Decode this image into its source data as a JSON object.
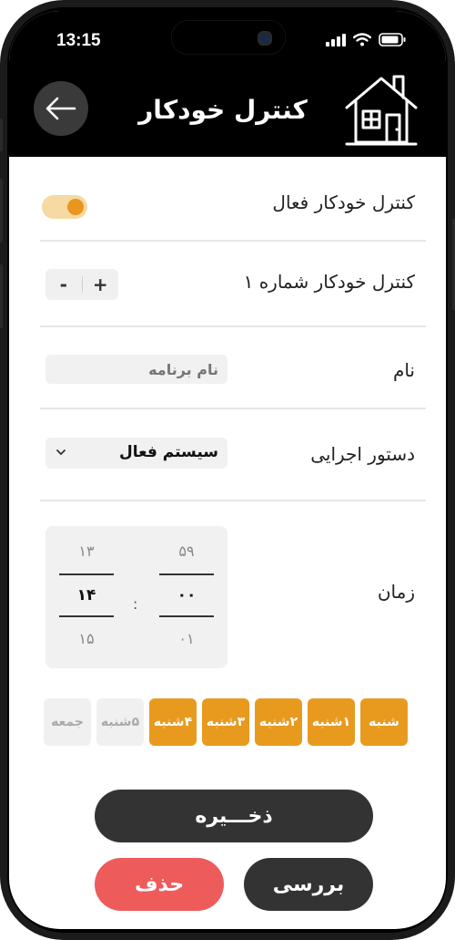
{
  "status_bar": {
    "time": "13:15"
  },
  "header": {
    "title": "کنترل خودکار",
    "back_icon": "arrow-left-icon",
    "logo_icon": "house-icon"
  },
  "rows": {
    "active": {
      "label": "کنترل خودکار فعال",
      "toggle_on": true
    },
    "number": {
      "label": "کنترل خودکار شماره ۱",
      "plus": "+",
      "minus": "-"
    },
    "name": {
      "label": "نام",
      "placeholder": "نام برنامه",
      "value": ""
    },
    "command": {
      "label": "دستور اجرایی",
      "selected": "سیستم فعال"
    },
    "time": {
      "label": "زمان",
      "hours": {
        "prev": "۱۳",
        "current": "۱۴",
        "next": "۱۵"
      },
      "minutes": {
        "prev": "۵۹",
        "current": "۰۰",
        "next": "۰۱"
      },
      "separator": ":"
    }
  },
  "days": [
    {
      "label": "شنبه",
      "active": true
    },
    {
      "label": "۱شنبه",
      "active": true
    },
    {
      "label": "۲شنبه",
      "active": true
    },
    {
      "label": "۳شنبه",
      "active": true
    },
    {
      "label": "۴شنبه",
      "active": true
    },
    {
      "label": "۵شنبه",
      "active": false
    },
    {
      "label": "جمعه",
      "active": false
    }
  ],
  "buttons": {
    "save": "ذخـــیره",
    "review": "بررسی",
    "delete": "حذف"
  },
  "colors": {
    "accent": "#e89a1f",
    "dark": "#333333",
    "danger": "#ee5b5b"
  }
}
